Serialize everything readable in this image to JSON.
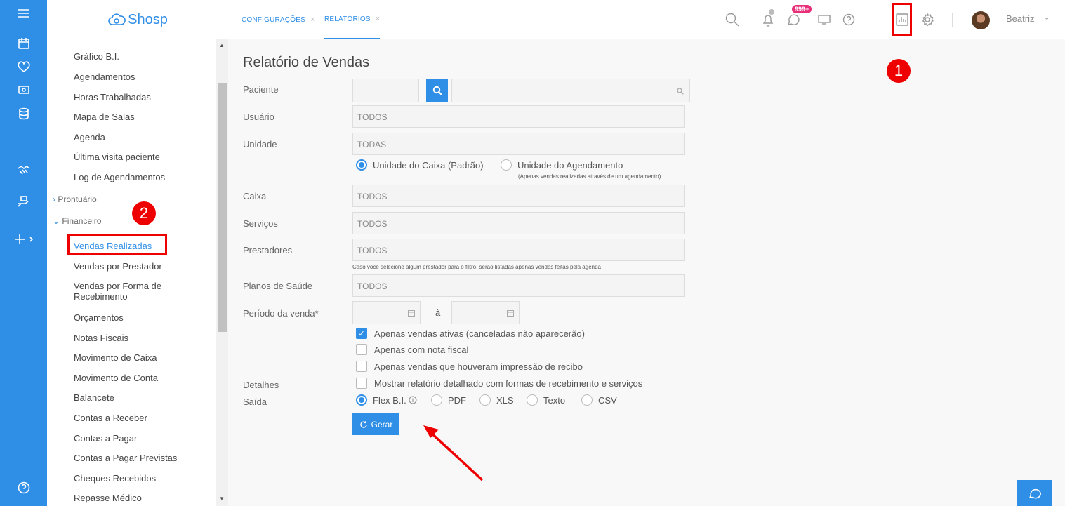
{
  "app": {
    "logo": "Shosp"
  },
  "tabs": [
    {
      "label": "CONFIGURAÇÕES",
      "close": "×"
    },
    {
      "label": "RELATÓRIOS",
      "close": "×"
    }
  ],
  "header": {
    "badge": "999+",
    "user": "Beatriz"
  },
  "menu": {
    "items_top": [
      "Gráfico B.I.",
      "Agendamentos",
      "Horas Trabalhadas",
      "Mapa de Salas",
      "Agenda",
      "Última visita paciente",
      "Log de Agendamentos"
    ],
    "group_prontuario": "Prontuário",
    "group_financeiro": "Financeiro",
    "items_financeiro": [
      "Vendas Realizadas",
      "Vendas por Prestador",
      "Vendas por Forma de Recebimento",
      "Orçamentos",
      "Notas Fiscais",
      "Movimento de Caixa",
      "Movimento de Conta",
      "Balancete",
      "Contas a Receber",
      "Contas a Pagar",
      "Contas a Pagar Previstas",
      "Cheques Recebidos",
      "Repasse Médico"
    ]
  },
  "form": {
    "title": "Relatório de Vendas",
    "paciente_label": "Paciente",
    "usuario_label": "Usuário",
    "usuario_value": "TODOS",
    "unidade_label": "Unidade",
    "unidade_value": "TODAS",
    "unidade_opt1": "Unidade do Caixa (Padrão)",
    "unidade_opt2": "Unidade do Agendamento",
    "unidade_opt2_note": "(Apenas vendas realizadas através de um agendamento)",
    "caixa_label": "Caixa",
    "caixa_value": "TODOS",
    "servicos_label": "Serviços",
    "servicos_value": "TODOS",
    "prestadores_label": "Prestadores",
    "prestadores_value": "TODOS",
    "prestadores_note": "Caso você selecione algum prestador para o filtro, serão listadas apenas vendas feitas pela agenda",
    "planos_label": "Planos de Saúde",
    "planos_value": "TODOS",
    "periodo_label": "Período da venda*",
    "periodo_sep": "à",
    "check1": "Apenas vendas ativas (canceladas não aparecerão)",
    "check2": "Apenas com nota fiscal",
    "check3": "Apenas vendas que houveram impressão de recibo",
    "detalhes_label": "Detalhes",
    "check4": "Mostrar relatório detalhado com formas de recebimento e serviços",
    "saida_label": "Saída",
    "saida_options": [
      "Flex B.I.",
      "PDF",
      "XLS",
      "Texto",
      "CSV"
    ],
    "gerar_label": "Gerar"
  },
  "annotations": {
    "step1": "1",
    "step2": "2"
  },
  "colors": {
    "primary": "#2f8ee6",
    "annotation": "#e00000",
    "badge": "#e8307a"
  }
}
